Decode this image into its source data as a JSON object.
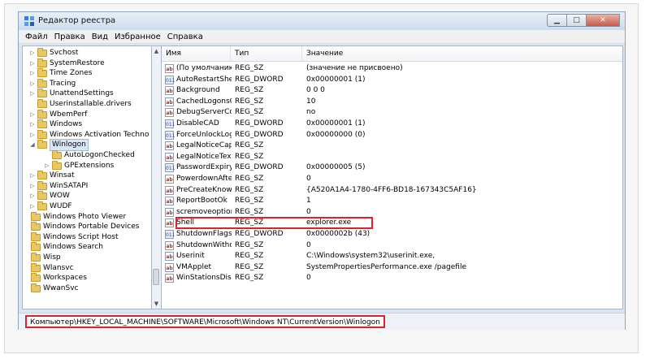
{
  "window": {
    "title": "Редактор реестра"
  },
  "menu": [
    "Файл",
    "Правка",
    "Вид",
    "Избранное",
    "Справка"
  ],
  "tree": [
    {
      "label": "Svchost",
      "expander": "▷"
    },
    {
      "label": "SystemRestore",
      "expander": "▷"
    },
    {
      "label": "Time Zones",
      "expander": "▷"
    },
    {
      "label": "Tracing",
      "expander": "▷"
    },
    {
      "label": "UnattendSettings",
      "expander": "▷"
    },
    {
      "label": "Userinstallable.drivers",
      "expander": ""
    },
    {
      "label": "WbemPerf",
      "expander": "▷"
    },
    {
      "label": "Windows",
      "expander": "▷"
    },
    {
      "label": "Windows Activation Techno",
      "expander": "▷"
    },
    {
      "label": "Winlogon",
      "expander": "◢",
      "selected": true
    },
    {
      "label": "AutoLogonChecked",
      "expander": ""
    },
    {
      "label": "GPExtensions",
      "expander": "▷"
    },
    {
      "label": "Winsat",
      "expander": "▷"
    },
    {
      "label": "WinSATAPI",
      "expander": "▷"
    },
    {
      "label": "WOW",
      "expander": "▷"
    },
    {
      "label": "WUDF",
      "expander": "▷"
    },
    {
      "label": "Windows Photo Viewer",
      "expander": ""
    },
    {
      "label": "Windows Portable Devices",
      "expander": ""
    },
    {
      "label": "Windows Script Host",
      "expander": ""
    },
    {
      "label": "Windows Search",
      "expander": ""
    },
    {
      "label": "Wisp",
      "expander": ""
    },
    {
      "label": "Wlansvc",
      "expander": ""
    },
    {
      "label": "Workspaces",
      "expander": ""
    },
    {
      "label": "WwanSvc",
      "expander": ""
    }
  ],
  "columns": {
    "name": "Имя",
    "type": "Тип",
    "value": "Значение"
  },
  "rows": [
    {
      "name": "(По умолчанию)",
      "type": "REG_SZ",
      "value": "(значение не присвоено)",
      "icon": "ab"
    },
    {
      "name": "AutoRestartShell",
      "type": "REG_DWORD",
      "value": "0x00000001 (1)",
      "icon": "bin"
    },
    {
      "name": "Background",
      "type": "REG_SZ",
      "value": "0 0 0",
      "icon": "ab"
    },
    {
      "name": "CachedLogonsC...",
      "type": "REG_SZ",
      "value": "10",
      "icon": "ab"
    },
    {
      "name": "DebugServerCo...",
      "type": "REG_SZ",
      "value": "no",
      "icon": "ab"
    },
    {
      "name": "DisableCAD",
      "type": "REG_DWORD",
      "value": "0x00000001 (1)",
      "icon": "bin"
    },
    {
      "name": "ForceUnlockLog...",
      "type": "REG_DWORD",
      "value": "0x00000000 (0)",
      "icon": "bin"
    },
    {
      "name": "LegalNoticeCap...",
      "type": "REG_SZ",
      "value": "",
      "icon": "ab"
    },
    {
      "name": "LegalNoticeText",
      "type": "REG_SZ",
      "value": "",
      "icon": "ab"
    },
    {
      "name": "PasswordExpiry...",
      "type": "REG_DWORD",
      "value": "0x00000005 (5)",
      "icon": "bin"
    },
    {
      "name": "PowerdownAfte...",
      "type": "REG_SZ",
      "value": "0",
      "icon": "ab"
    },
    {
      "name": "PreCreateKnow...",
      "type": "REG_SZ",
      "value": "{A520A1A4-1780-4FF6-BD18-167343C5AF16}",
      "icon": "ab"
    },
    {
      "name": "ReportBootOk",
      "type": "REG_SZ",
      "value": "1",
      "icon": "ab"
    },
    {
      "name": "scremoveoption",
      "type": "REG_SZ",
      "value": "0",
      "icon": "ab"
    },
    {
      "name": "Shell",
      "type": "REG_SZ",
      "value": "explorer.exe",
      "icon": "ab"
    },
    {
      "name": "ShutdownFlags",
      "type": "REG_DWORD",
      "value": "0x0000002b (43)",
      "icon": "bin"
    },
    {
      "name": "ShutdownWitho...",
      "type": "REG_SZ",
      "value": "0",
      "icon": "ab"
    },
    {
      "name": "Userinit",
      "type": "REG_SZ",
      "value": "C:\\Windows\\system32\\userinit.exe,",
      "icon": "ab"
    },
    {
      "name": "VMApplet",
      "type": "REG_SZ",
      "value": "SystemPropertiesPerformance.exe /pagefile",
      "icon": "ab"
    },
    {
      "name": "WinStationsDisa...",
      "type": "REG_SZ",
      "value": "0",
      "icon": "ab"
    }
  ],
  "status": {
    "path": "Компьютер\\HKEY_LOCAL_MACHINE\\SOFTWARE\\Microsoft\\Windows NT\\CurrentVersion\\Winlogon"
  },
  "colors": {
    "highlight": "#d9242b",
    "selection": "#d9e6f6"
  }
}
